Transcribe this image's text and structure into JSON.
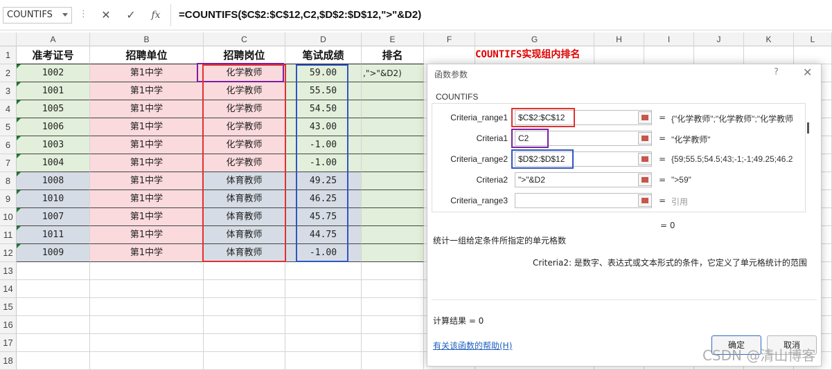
{
  "formula_bar": {
    "name_box": "COUNTIFS",
    "dots": "⋮",
    "cancel_glyph": "✕",
    "enter_glyph": "✓",
    "fx_glyph": "fx",
    "formula": "=COUNTIFS($C$2:$C$12,C2,$D$2:$D$12,\">\"&D2)"
  },
  "columns": [
    "A",
    "B",
    "C",
    "D",
    "E",
    "F",
    "G",
    "H",
    "I",
    "J",
    "K",
    "L"
  ],
  "rows": [
    "1",
    "2",
    "3",
    "4",
    "5",
    "6",
    "7",
    "8",
    "9",
    "10",
    "11",
    "12",
    "13",
    "14",
    "15",
    "16",
    "17",
    "18"
  ],
  "headers": {
    "a": "准考证号",
    "b": "招聘单位",
    "c": "招聘岗位",
    "d": "笔试成绩",
    "e": "排名"
  },
  "g1_note": "COUNTIFS实现组内排名",
  "e2_edit": ",\">\"&D2)",
  "table": [
    {
      "id": "1002",
      "unit": "第1中学",
      "post": "化学教师",
      "score": "59.00"
    },
    {
      "id": "1001",
      "unit": "第1中学",
      "post": "化学教师",
      "score": "55.50"
    },
    {
      "id": "1005",
      "unit": "第1中学",
      "post": "化学教师",
      "score": "54.50"
    },
    {
      "id": "1006",
      "unit": "第1中学",
      "post": "化学教师",
      "score": "43.00"
    },
    {
      "id": "1003",
      "unit": "第1中学",
      "post": "化学教师",
      "score": "-1.00"
    },
    {
      "id": "1004",
      "unit": "第1中学",
      "post": "化学教师",
      "score": "-1.00"
    },
    {
      "id": "1008",
      "unit": "第1中学",
      "post": "体育教师",
      "score": "49.25"
    },
    {
      "id": "1010",
      "unit": "第1中学",
      "post": "体育教师",
      "score": "46.25"
    },
    {
      "id": "1007",
      "unit": "第1中学",
      "post": "体育教师",
      "score": "45.75"
    },
    {
      "id": "1011",
      "unit": "第1中学",
      "post": "体育教师",
      "score": "44.75"
    },
    {
      "id": "1009",
      "unit": "第1中学",
      "post": "体育教师",
      "score": "-1.00"
    }
  ],
  "colors": {
    "green": "#e2efda",
    "pink": "#fadadd",
    "gray": "#d6dce5",
    "red_box": "#e03030",
    "purple_box": "#7b1fa2",
    "blue_box": "#2f55c0"
  },
  "dialog": {
    "title": "函数参数",
    "help_glyph": "?",
    "close_glyph": "✕",
    "function_name": "COUNTIFS",
    "args": [
      {
        "label": "Criteria_range1",
        "value": "$C$2:$C$12",
        "eq": "=",
        "result": "{\"化学教师\";\"化学教师\";\"化学教师"
      },
      {
        "label": "Criteria1",
        "value": "C2",
        "eq": "=",
        "result": "\"化学教师\""
      },
      {
        "label": "Criteria_range2",
        "value": "$D$2:$D$12",
        "eq": "=",
        "result": "{59;55.5;54.5;43;-1;-1;49.25;46.2"
      },
      {
        "label": "Criteria2",
        "value": "\">\"&D2",
        "eq": "=",
        "result": "\">59\""
      },
      {
        "label": "Criteria_range3",
        "value": "",
        "eq": "=",
        "result": "引用"
      }
    ],
    "formula_result_line": "= 0",
    "description": "统计一组给定条件所指定的单元格数",
    "criteria_desc": "Criteria2:   是数字、表达式或文本形式的条件，它定义了单元格统计的范围",
    "calc_result": "计算结果 =   0",
    "help_link": "有关该函数的帮助(H)",
    "ok": "确定",
    "cancel": "取消"
  },
  "watermark": "CSDN @清山博客"
}
